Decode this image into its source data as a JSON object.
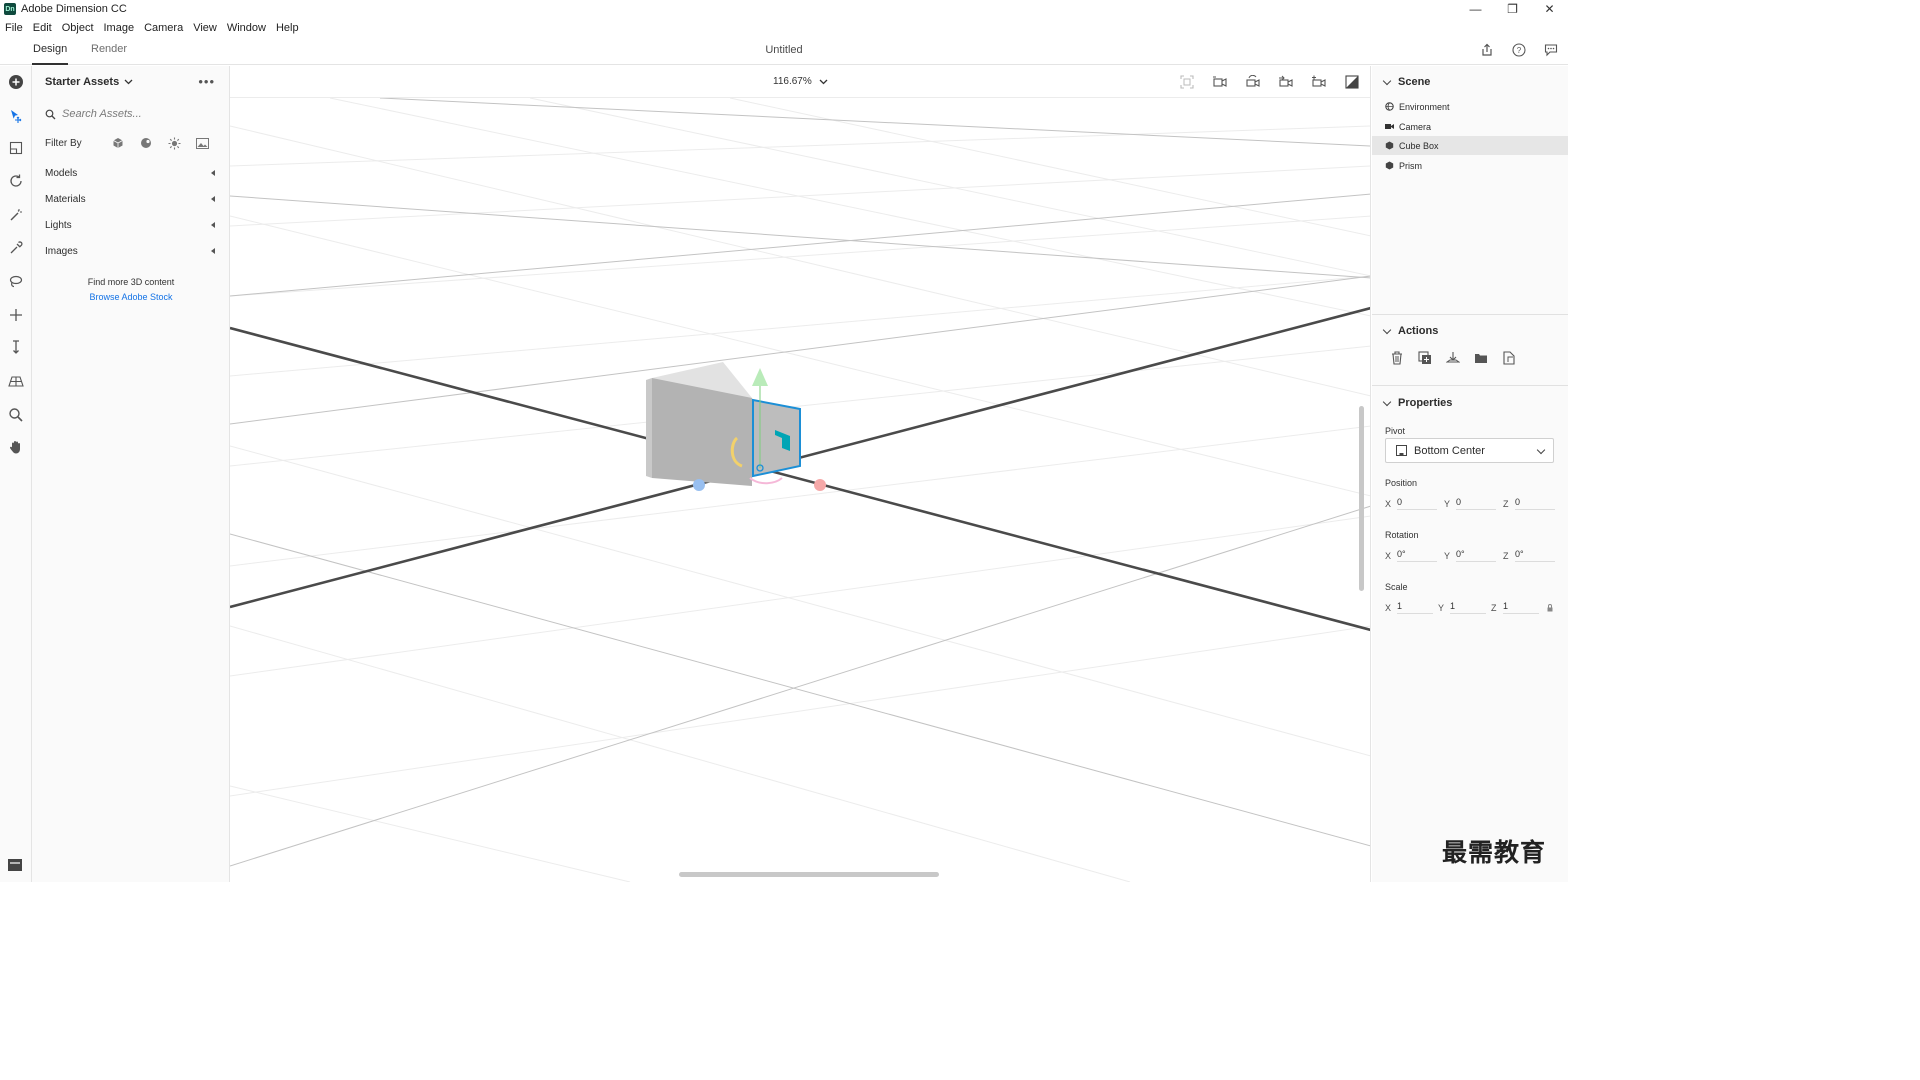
{
  "window": {
    "app_icon_text": "Dn",
    "title": "Adobe Dimension CC",
    "controls": {
      "minimize": "—",
      "restore": "❐",
      "close": "✕"
    }
  },
  "menu": [
    "File",
    "Edit",
    "Object",
    "Image",
    "Camera",
    "View",
    "Window",
    "Help"
  ],
  "topbar": {
    "tabs": [
      {
        "label": "Design",
        "active": true
      },
      {
        "label": "Render",
        "active": false
      }
    ],
    "document_title": "Untitled",
    "icons": [
      "share-icon",
      "help-icon",
      "feedback-icon"
    ]
  },
  "tools": [
    "add-icon",
    "select-icon",
    "frame-icon",
    "orbit-icon",
    "magic-wand-icon",
    "eyedropper-icon",
    "lasso-icon",
    "move-icon",
    "vertical-move-icon",
    "perspective-icon",
    "zoom-icon",
    "hand-icon"
  ],
  "assets": {
    "header": "Starter Assets",
    "more": "•••",
    "search_placeholder": "Search Assets...",
    "filter_label": "Filter By",
    "filter_icons": [
      "models-filter-icon",
      "materials-filter-icon",
      "lights-filter-icon",
      "images-filter-icon"
    ],
    "categories": [
      "Models",
      "Materials",
      "Lights",
      "Images"
    ],
    "find_more": "Find more 3D content",
    "browse_link": "Browse Adobe Stock"
  },
  "viewport": {
    "zoom": "116.67%",
    "icons": [
      "frame-selection-icon",
      "camera-orbit-icon",
      "camera-pan-icon",
      "camera-dolly-icon",
      "camera-bookmark-icon",
      "render-preview-icon"
    ]
  },
  "scene": {
    "title": "Scene",
    "items": [
      {
        "label": "Environment",
        "icon": "environment-icon",
        "selected": false
      },
      {
        "label": "Camera",
        "icon": "camera-icon",
        "selected": false
      },
      {
        "label": "Cube Box",
        "icon": "model-icon",
        "selected": true
      },
      {
        "label": "Prism",
        "icon": "model-icon",
        "selected": false
      }
    ]
  },
  "actions": {
    "title": "Actions",
    "icons": [
      "delete-icon",
      "duplicate-icon",
      "place-on-ground-icon",
      "group-icon",
      "export-selected-icon"
    ]
  },
  "properties": {
    "title": "Properties",
    "pivot_label": "Pivot",
    "pivot_value": "Bottom Center",
    "position_label": "Position",
    "position": {
      "x": "0",
      "y": "0",
      "z": "0"
    },
    "rotation_label": "Rotation",
    "rotation": {
      "x": "0°",
      "y": "0°",
      "z": "0°"
    },
    "scale_label": "Scale",
    "scale": {
      "x": "1",
      "y": "1",
      "z": "1"
    },
    "axis_labels": {
      "x": "X",
      "y": "Y",
      "z": "Z"
    }
  },
  "colors": {
    "accent": "#1473e6",
    "selection_outline": "#1c8fd6",
    "gizmo_teal": "#00a5b5",
    "gizmo_green": "#a8e6a8",
    "gizmo_red": "#f5a8a8",
    "gizmo_blue": "#98bff0",
    "gizmo_yellow": "#f2d16b"
  },
  "watermark": "最需教育"
}
